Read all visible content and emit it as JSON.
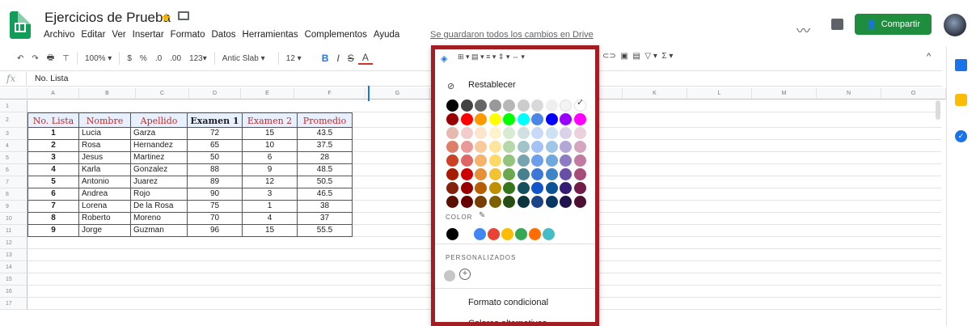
{
  "header": {
    "title": "Ejercicios de Prueba",
    "menus": [
      "Archivo",
      "Editar",
      "Ver",
      "Insertar",
      "Formato",
      "Datos",
      "Herramientas",
      "Complementos",
      "Ayuda"
    ],
    "saved_status": "Se guardaron todos los cambios en Drive",
    "share_label": "Compartir",
    "share_color": "#1e8e3e"
  },
  "toolbar": {
    "undo": "↶",
    "redo": "↷",
    "print": "🖶",
    "paint_format": "⊤",
    "zoom": "100%",
    "currency": "$",
    "percent": "%",
    "dec_less": ".0",
    "dec_more": ".00",
    "more_formats": "123",
    "font": "Antic Slab",
    "font_size": "12",
    "bold": "B",
    "italic": "I",
    "strike": "S",
    "text_color": "A",
    "fill_icon": "paint-bucket-icon",
    "collapse": "^"
  },
  "formula_bar": {
    "fx": "fx",
    "value": "No. Lista"
  },
  "grid": {
    "col_letters": [
      "A",
      "B",
      "C",
      "D",
      "E",
      "F",
      "G",
      "H",
      "I",
      "J",
      "K",
      "L",
      "M",
      "N",
      "O"
    ],
    "row_numbers": [
      "1",
      "2",
      "3",
      "4",
      "5",
      "6",
      "7",
      "8",
      "9",
      "10",
      "11",
      "12",
      "13",
      "14",
      "15",
      "16",
      "17"
    ],
    "table_headers": [
      "No. Lista",
      "Nombre",
      "Apellido",
      "Examen 1",
      "Examen 2",
      "Promedio"
    ],
    "rows": [
      [
        "1",
        "Lucia",
        "Garza",
        "72",
        "15",
        "43.5"
      ],
      [
        "2",
        "Rosa",
        "Hernandez",
        "65",
        "10",
        "37.5"
      ],
      [
        "3",
        "Jesus",
        "Martinez",
        "50",
        "6",
        "28"
      ],
      [
        "4",
        "Karla",
        "Gonzalez",
        "88",
        "9",
        "48.5"
      ],
      [
        "5",
        "Antonio",
        "Juarez",
        "89",
        "12",
        "50.5"
      ],
      [
        "6",
        "Andrea",
        "Rojo",
        "90",
        "3",
        "46.5"
      ],
      [
        "7",
        "Lorena",
        "De la Rosa",
        "75",
        "1",
        "38"
      ],
      [
        "8",
        "Roberto",
        "Moreno",
        "70",
        "4",
        "37"
      ],
      [
        "9",
        "Jorge",
        "Guzman",
        "96",
        "15",
        "55.5"
      ]
    ],
    "header_fill": "#e8f0fe",
    "header_text_color": "#c62828"
  },
  "palette": {
    "reset_label": "Restablecer",
    "color_section_label": "COLOR",
    "custom_section_label": "PERSONALIZADOS",
    "conditional_label": "Formato condicional",
    "alternating_label": "Colores alternativos",
    "border_color": "#a31e22",
    "swatch_rows": [
      [
        "#000000",
        "#434343",
        "#666666",
        "#999999",
        "#b7b7b7",
        "#cccccc",
        "#d9d9d9",
        "#efefef",
        "#f3f3f3",
        "#ffffff"
      ],
      [
        "#980000",
        "#ff0000",
        "#ff9900",
        "#ffff00",
        "#00ff00",
        "#00ffff",
        "#4a86e8",
        "#0000ff",
        "#9900ff",
        "#ff00ff"
      ],
      [
        "#e6b8af",
        "#f4cccc",
        "#fce5cd",
        "#fff2cc",
        "#d9ead3",
        "#d0e0e3",
        "#c9daf8",
        "#cfe2f3",
        "#d9d2e9",
        "#ead1dc"
      ],
      [
        "#dd7e6b",
        "#ea9999",
        "#f9cb9c",
        "#ffe599",
        "#b6d7a8",
        "#a2c4c9",
        "#a4c2f4",
        "#9fc5e8",
        "#b4a7d6",
        "#d5a6bd"
      ],
      [
        "#cc4125",
        "#e06666",
        "#f6b26b",
        "#ffd966",
        "#93c47d",
        "#76a5af",
        "#6d9eeb",
        "#6fa8dc",
        "#8e7cc3",
        "#c27ba0"
      ],
      [
        "#a61c00",
        "#cc0000",
        "#e69138",
        "#f1c232",
        "#6aa84f",
        "#45818e",
        "#3c78d8",
        "#3d85c6",
        "#674ea7",
        "#a64d79"
      ],
      [
        "#85200c",
        "#990000",
        "#b45f06",
        "#bf9000",
        "#38761d",
        "#134f5c",
        "#1155cc",
        "#0b5394",
        "#351c75",
        "#741b47"
      ],
      [
        "#5b0f00",
        "#660000",
        "#783f04",
        "#7f6000",
        "#274e13",
        "#0c343d",
        "#1c4587",
        "#073763",
        "#20124d",
        "#4c1130"
      ]
    ],
    "theme_colors": [
      "#000000",
      "#ffffff",
      "#4285f4",
      "#ea4335",
      "#fbbc04",
      "#34a853",
      "#ff6d01",
      "#46bdc6"
    ]
  }
}
